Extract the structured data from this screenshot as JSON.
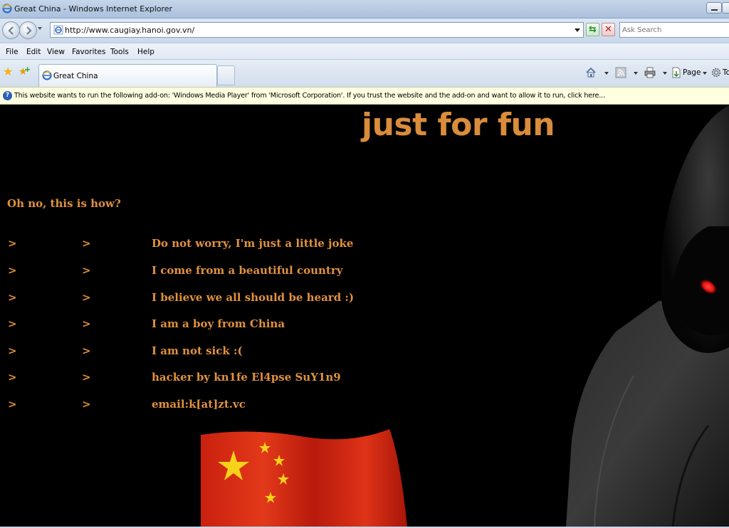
{
  "window": {
    "title": "Great China - Windows Internet Explorer"
  },
  "address": {
    "url": "http://www.caugiay.hanoi.gov.vn/",
    "search_placeholder": "Ask Search"
  },
  "menu": [
    "File",
    "Edit",
    "View",
    "Favorites",
    "Tools",
    "Help"
  ],
  "tabs": [
    {
      "label": "Great China",
      "active": true
    }
  ],
  "command_bar": {
    "page_label": "Page",
    "tools_label": "To"
  },
  "infobar": {
    "text": "This website wants to run the following add-on: 'Windows Media Player' from 'Microsoft Corporation'. If you trust the website and the add-on and want to allow it to run, click here..."
  },
  "page": {
    "headline": "just for fun",
    "subhead": "Oh no, this is how?",
    "arrow": ">",
    "messages": [
      "Do not worry, I'm just a little joke",
      "I come from a beautiful country",
      "I believe we all should be heard :)",
      "I am a boy from China",
      "I am not sick :(",
      "hacker by kn1fe El4pse SuY1n9",
      "email:k[at]zt.vc"
    ],
    "colors": {
      "text": "#e0913d",
      "headline": "#d98c3a",
      "background": "#000000",
      "flag_red": "#d42a12",
      "flag_star": "#f7d21a",
      "hacker_eye": "#ff1a1a"
    }
  }
}
